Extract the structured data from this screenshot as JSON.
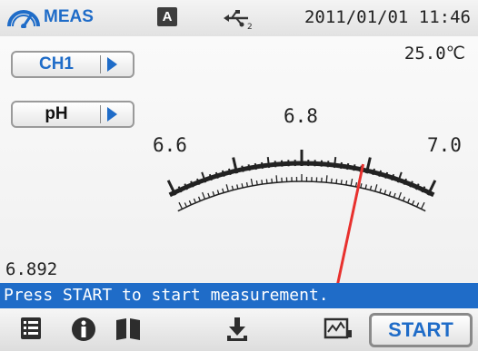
{
  "status_bar": {
    "mode_label": "MEAS",
    "range_badge": "A",
    "usb_icon": "usb-icon",
    "datetime": "2011/01/01 11:46"
  },
  "measurement": {
    "temperature": "25.0℃",
    "channel_button": "CH1",
    "parameter_button": "pH",
    "reading": "6.892"
  },
  "meter": {
    "scale_labels": [
      "6.6",
      "6.8",
      "7.0"
    ],
    "scale_min": 6.6,
    "scale_max": 7.0,
    "needle_value": 6.892,
    "needle_color": "#e8312e"
  },
  "message": "Press START to start measurement.",
  "toolbar": {
    "icons": [
      "menu-list-icon",
      "info-icon",
      "book-icon",
      "download-icon",
      "graph-icon"
    ],
    "start_label": "START"
  },
  "colors": {
    "accent": "#1f6cc8",
    "needle": "#e8312e"
  }
}
